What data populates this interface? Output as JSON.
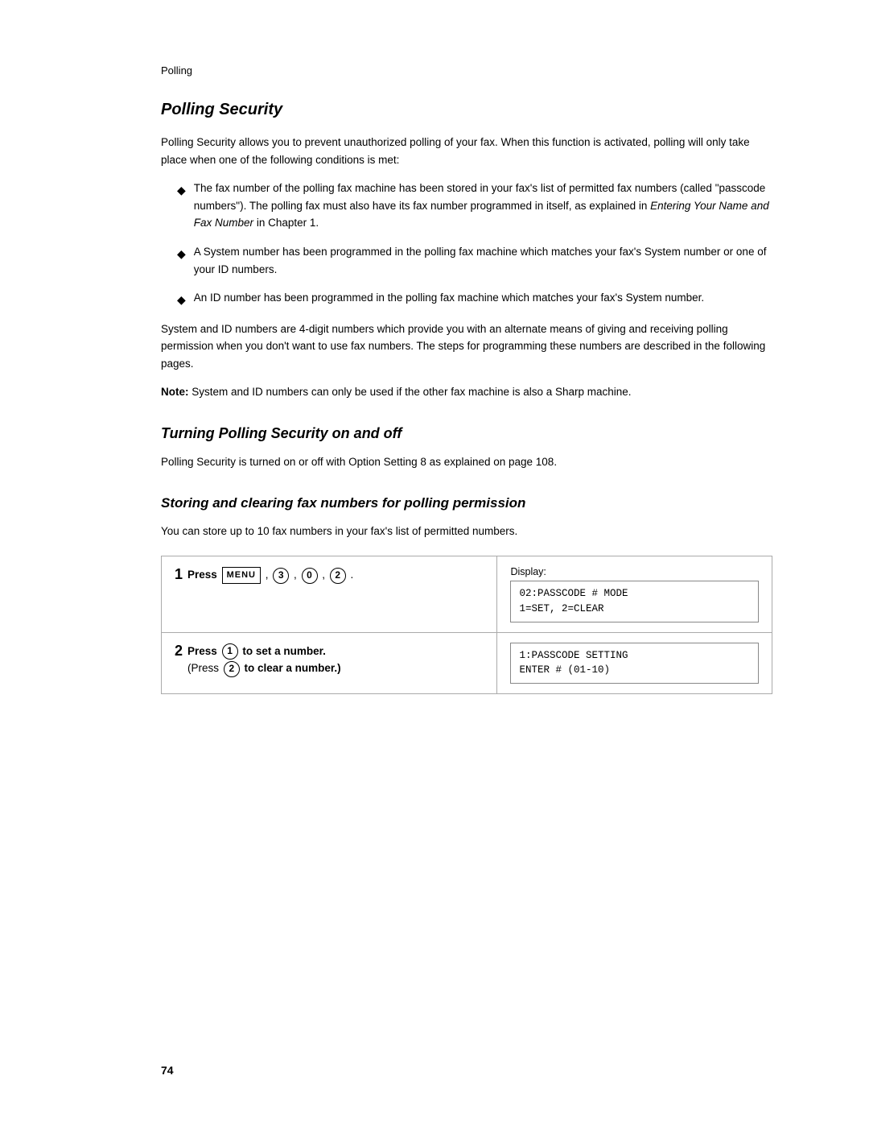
{
  "page": {
    "header": "Polling",
    "page_number": "74",
    "sections": {
      "polling_security": {
        "title": "Polling Security",
        "intro": "Polling Security allows you to prevent unauthorized polling of your fax. When this function is activated, polling will only take place when one of the following conditions is met:",
        "bullets": [
          {
            "text": "The fax number of the polling fax machine has been stored in your fax's list of permitted fax numbers (called \"passcode numbers\"). The polling fax must also have its fax number programmed in itself, as explained in ",
            "italic_part": "Entering Your Name and Fax Number",
            "text_after": " in Chapter 1."
          },
          {
            "text": "A System number has been programmed in the polling fax machine which matches your fax's System number or one of your ID numbers."
          },
          {
            "text": "An ID number has been programmed in the polling fax machine which matches your fax's System number."
          }
        ],
        "body2": "System and ID numbers are 4-digit numbers which provide you with an alternate means of giving and receiving polling permission when you don't want to use fax numbers. The steps for programming these numbers are described in the following pages.",
        "note": "Note: System and ID numbers can only be used if the other fax machine is also a Sharp machine."
      },
      "turning_on_off": {
        "title": "Turning Polling Security on and off",
        "body": "Polling Security is turned on or off with Option Setting 8 as explained on page 108."
      },
      "storing_clearing": {
        "title": "Storing and clearing fax numbers for polling permission",
        "body": "You can store up to 10 fax numbers in your fax's list of permitted numbers.",
        "steps": [
          {
            "number": "1",
            "instruction_prefix": "Press",
            "keys": [
              "MENU",
              "3",
              "0",
              "2"
            ],
            "display_label": "Display:",
            "display_line1": "02:PASSCODE # MODE",
            "display_line2": "1=SET, 2=CLEAR"
          },
          {
            "number": "2",
            "instruction_main": "Press",
            "key_1": "1",
            "instruction_after_1": "to set a number.",
            "instruction_paren_prefix": "(Press",
            "key_2": "2",
            "instruction_after_2": "to clear a number.)",
            "display_line1": "1:PASSCODE SETTING",
            "display_line2": "ENTER # (01-10)"
          }
        ]
      }
    }
  }
}
